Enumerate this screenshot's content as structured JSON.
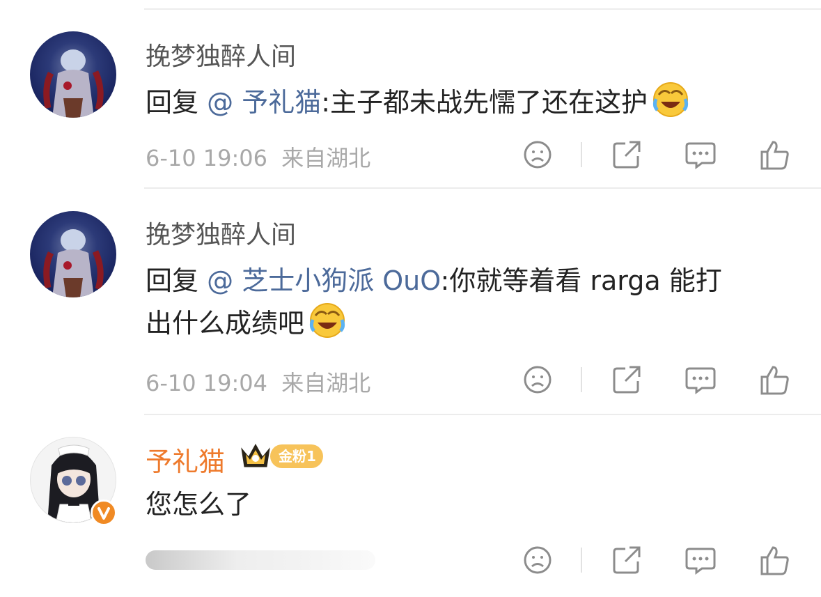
{
  "comments": [
    {
      "username": "挽梦独醉人间",
      "reply_prefix": "回复",
      "mention": "@ 予礼猫",
      "text": ":主子都未战先懦了还在这护",
      "emoji": "laughing-crying-emoji",
      "timestamp": "6-10 19:06",
      "location": "来自湖北"
    },
    {
      "username": "挽梦独醉人间",
      "reply_prefix": "回复",
      "mention": "@ 芝士小狗派 OuO",
      "text_line1": ":你就等着看 rarga 能打",
      "text_line2": "出什么成绩吧",
      "emoji": "laughing-crying-emoji",
      "timestamp": "6-10 19:04",
      "location": "来自湖北"
    },
    {
      "username": "予礼猫",
      "badge": "金粉1",
      "text": "您怎么了",
      "verified": true
    }
  ],
  "colors": {
    "mention": "#4c6a9a",
    "vip_name": "#ee7a2c",
    "meta": "#a8a8a8",
    "badge": "#f7c35a",
    "verified": "#f08a24"
  },
  "actions": [
    "dislike-icon",
    "share-icon",
    "comment-icon",
    "like-icon"
  ]
}
